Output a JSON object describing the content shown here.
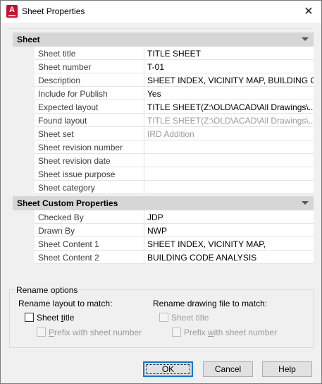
{
  "window": {
    "title": "Sheet Properties",
    "app_icon_letter": "A",
    "close_glyph": "✕"
  },
  "sheet_section": {
    "header": "Sheet",
    "rows": [
      {
        "name": "Sheet title",
        "value": "TITLE SHEET"
      },
      {
        "name": "Sheet number",
        "value": "T-01"
      },
      {
        "name": "Description",
        "value": "SHEET INDEX, VICINITY MAP, BUILDING C..."
      },
      {
        "name": "Include for Publish",
        "value": "Yes"
      },
      {
        "name": "Expected layout",
        "value": "TITLE SHEET(Z:\\OLD\\ACAD\\All Drawings\\..."
      },
      {
        "name": "Found layout",
        "value": "TITLE SHEET(Z:\\OLD\\ACAD\\All Drawings\\..."
      },
      {
        "name": "Sheet set",
        "value": "IRD Addition"
      },
      {
        "name": "Sheet revision number",
        "value": ""
      },
      {
        "name": "Sheet revision date",
        "value": ""
      },
      {
        "name": "Sheet issue purpose",
        "value": ""
      },
      {
        "name": "Sheet category",
        "value": ""
      }
    ]
  },
  "custom_section": {
    "header": "Sheet Custom Properties",
    "rows": [
      {
        "name": "Checked By",
        "value": "JDP"
      },
      {
        "name": "Drawn By",
        "value": "NWP"
      },
      {
        "name": "Sheet Content 1",
        "value": "SHEET INDEX, VICINITY MAP,"
      },
      {
        "name": "Sheet Content 2",
        "value": "BUILDING CODE ANALYSIS"
      }
    ]
  },
  "rename": {
    "group_label": "Rename options",
    "layout_heading": "Rename layout to match:",
    "drawing_heading": "Rename drawing file to match:",
    "layout_sheet_title": {
      "pre": "Sheet ",
      "ul": "t",
      "post": "itle"
    },
    "layout_prefix": {
      "pre": "",
      "ul": "P",
      "post": "refix with sheet number"
    },
    "drawing_sheet_title": {
      "pre": "Sheet title",
      "ul": "",
      "post": ""
    },
    "drawing_prefix": {
      "pre": "Prefix ",
      "ul": "w",
      "post": "ith sheet number"
    }
  },
  "buttons": {
    "ok": "OK",
    "cancel": "Cancel",
    "help": "Help"
  }
}
